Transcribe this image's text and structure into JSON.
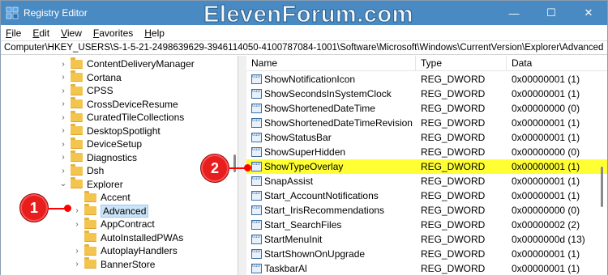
{
  "window": {
    "title": "Registry Editor",
    "watermark": "ElevenForum.com",
    "minimize_glyph": "—",
    "maximize_glyph": "☐",
    "close_glyph": "✕"
  },
  "menu": {
    "items": [
      {
        "first": "F",
        "rest": "ile"
      },
      {
        "first": "E",
        "rest": "dit"
      },
      {
        "first": "V",
        "rest": "iew"
      },
      {
        "first": "F",
        "rest": "avorites"
      },
      {
        "first": "H",
        "rest": "elp"
      }
    ]
  },
  "address": "Computer\\HKEY_USERS\\S-1-5-21-2498639629-3946114050-4100787084-1001\\Software\\Microsoft\\Windows\\CurrentVersion\\Explorer\\Advanced",
  "tree": [
    {
      "label": "ContentDeliveryManager",
      "chevron": "›",
      "indent": 0
    },
    {
      "label": "Cortana",
      "chevron": "›",
      "indent": 0
    },
    {
      "label": "CPSS",
      "chevron": "›",
      "indent": 0
    },
    {
      "label": "CrossDeviceResume",
      "chevron": "›",
      "indent": 0
    },
    {
      "label": "CuratedTileCollections",
      "chevron": "›",
      "indent": 0
    },
    {
      "label": "DesktopSpotlight",
      "chevron": "›",
      "indent": 0
    },
    {
      "label": "DeviceSetup",
      "chevron": "›",
      "indent": 0
    },
    {
      "label": "Diagnostics",
      "chevron": "›",
      "indent": 0
    },
    {
      "label": "Dsh",
      "chevron": "›",
      "indent": 0
    },
    {
      "label": "Explorer",
      "chevron": "⌄",
      "indent": 0
    },
    {
      "label": "Accent",
      "chevron": "",
      "indent": 1
    },
    {
      "label": "Advanced",
      "chevron": "›",
      "indent": 1,
      "selected": true
    },
    {
      "label": "AppContract",
      "chevron": "›",
      "indent": 1
    },
    {
      "label": "AutoInstalledPWAs",
      "chevron": "",
      "indent": 1
    },
    {
      "label": "AutoplayHandlers",
      "chevron": "›",
      "indent": 1
    },
    {
      "label": "BannerStore",
      "chevron": "›",
      "indent": 1
    }
  ],
  "columns": {
    "name": "Name",
    "type": "Type",
    "data": "Data"
  },
  "values": [
    {
      "name": "ShowNotificationIcon",
      "type": "REG_DWORD",
      "data": "0x00000001 (1)"
    },
    {
      "name": "ShowSecondsInSystemClock",
      "type": "REG_DWORD",
      "data": "0x00000001 (1)"
    },
    {
      "name": "ShowShortenedDateTime",
      "type": "REG_DWORD",
      "data": "0x00000000 (0)"
    },
    {
      "name": "ShowShortenedDateTimeRevision",
      "type": "REG_DWORD",
      "data": "0x00000001 (1)"
    },
    {
      "name": "ShowStatusBar",
      "type": "REG_DWORD",
      "data": "0x00000001 (1)"
    },
    {
      "name": "ShowSuperHidden",
      "type": "REG_DWORD",
      "data": "0x00000000 (0)"
    },
    {
      "name": "ShowTypeOverlay",
      "type": "REG_DWORD",
      "data": "0x00000001 (1)",
      "highlight": true
    },
    {
      "name": "SnapAssist",
      "type": "REG_DWORD",
      "data": "0x00000001 (1)"
    },
    {
      "name": "Start_AccountNotifications",
      "type": "REG_DWORD",
      "data": "0x00000001 (1)"
    },
    {
      "name": "Start_IrisRecommendations",
      "type": "REG_DWORD",
      "data": "0x00000000 (0)"
    },
    {
      "name": "Start_SearchFiles",
      "type": "REG_DWORD",
      "data": "0x00000002 (2)"
    },
    {
      "name": "StartMenuInit",
      "type": "REG_DWORD",
      "data": "0x0000000d (13)"
    },
    {
      "name": "StartShownOnUpgrade",
      "type": "REG_DWORD",
      "data": "0x00000001 (1)"
    },
    {
      "name": "TaskbarAl",
      "type": "REG_DWORD",
      "data": "0x00000001 (1)"
    }
  ],
  "reg_icon_text": "010\n110",
  "callouts": [
    {
      "number": "1"
    },
    {
      "number": "2"
    }
  ],
  "colors": {
    "titlebar": "#4a8ac2",
    "highlight": "#ffff33",
    "selection": "#cce4f7",
    "callout": "#e81e1e"
  }
}
